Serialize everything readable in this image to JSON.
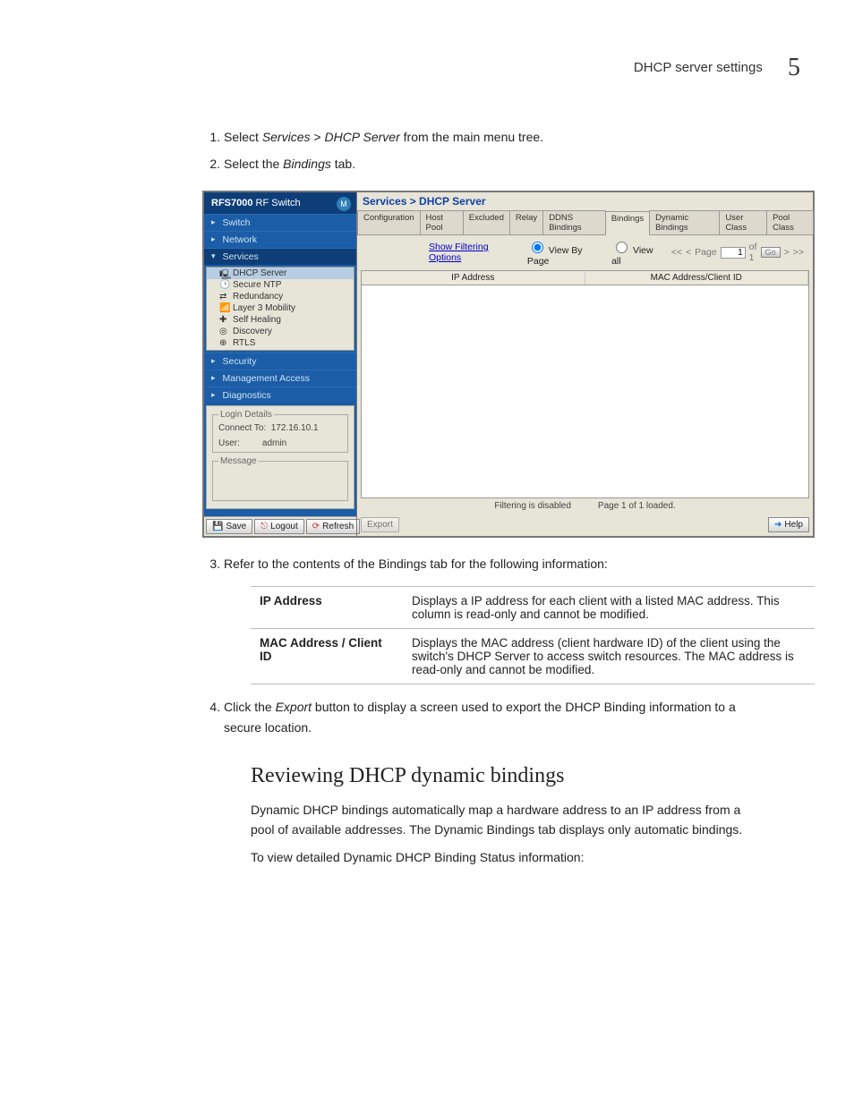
{
  "header": {
    "title": "DHCP server settings",
    "page_number": "5"
  },
  "steps": {
    "s1_pre": "Select ",
    "s1_em1": "Services",
    "s1_sep": " > ",
    "s1_em2": "DHCP Server",
    "s1_post": " from the main menu tree.",
    "s2_pre": "Select the ",
    "s2_em": "Bindings",
    "s2_post": " tab.",
    "s3": "Refer to the contents of the Bindings tab for the following information:",
    "s4_pre": "Click the ",
    "s4_em": "Export",
    "s4_post": " button to display a screen used to export the DHCP Binding information to a secure location."
  },
  "shot": {
    "nav_title_strong": "RFS7000",
    "nav_title_rest": " RF Switch",
    "logo_icon": "motorola-logo-icon",
    "nav": [
      "Switch",
      "Network",
      "Services",
      "Security",
      "Management Access",
      "Diagnostics"
    ],
    "tree": [
      "DHCP Server",
      "Secure NTP",
      "Redundancy",
      "Layer 3 Mobility",
      "Self Healing",
      "Discovery",
      "RTLS"
    ],
    "login": {
      "legend": "Login Details",
      "connect_label": "Connect To:",
      "connect_val": "172.16.10.1",
      "user_label": "User:",
      "user_val": "admin",
      "msg_legend": "Message"
    },
    "btns": {
      "save": "Save",
      "logout": "Logout",
      "refresh": "Refresh"
    },
    "breadcrumb": "Services > DHCP Server",
    "tabs": [
      "Configuration",
      "Host Pool",
      "Excluded",
      "Relay",
      "DDNS Bindings",
      "Bindings",
      "Dynamic Bindings",
      "User Class",
      "Pool Class"
    ],
    "filter_link": "Show Filtering Options",
    "view_page": "View By Page",
    "view_all": "View all",
    "pager": {
      "first": "<<",
      "prev": "<",
      "label": "Page",
      "val": "1",
      "of": "of 1",
      "go": "Go",
      "next": ">",
      "last": ">>"
    },
    "cols": [
      "IP Address",
      "MAC Address/Client ID"
    ],
    "status_left": "Filtering is disabled",
    "status_right": "Page 1 of 1 loaded.",
    "export_btn": "Export",
    "help_btn": "Help"
  },
  "def": [
    {
      "k": "IP Address",
      "v": "Displays a IP address for each client with a listed MAC address. This column is read-only and cannot be modified."
    },
    {
      "k": "MAC Address / Client ID",
      "v": "Displays the MAC address (client hardware ID) of the client using the switch's DHCP Server to access switch resources. The MAC address is read-only and cannot be modified."
    }
  ],
  "section": {
    "title": "Reviewing DHCP dynamic bindings",
    "p1": "Dynamic DHCP bindings automatically map a hardware address to an IP address from a pool of available addresses. The Dynamic Bindings tab displays only automatic bindings.",
    "p2": "To view detailed Dynamic DHCP Binding Status information:"
  }
}
